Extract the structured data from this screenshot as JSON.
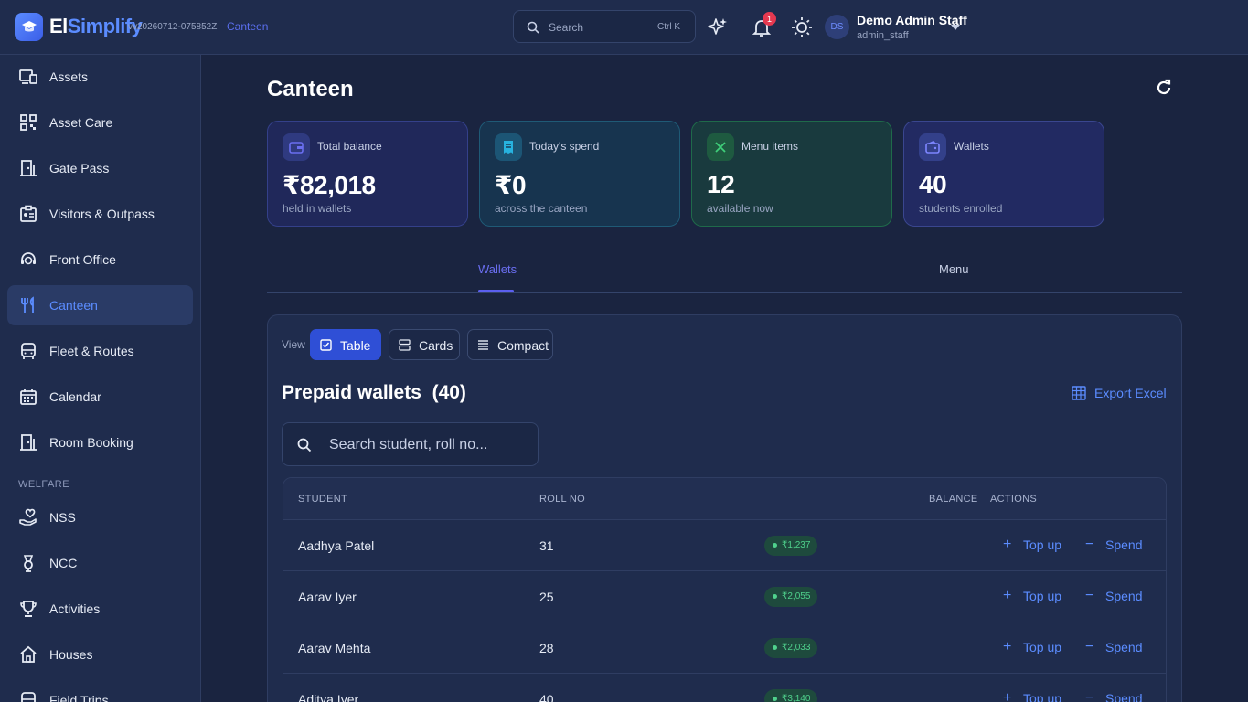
{
  "header": {
    "brand_part1": "El",
    "brand_part2": "Simplify",
    "version": "vv20260712-075852Z",
    "breadcrumb": "Canteen",
    "search_placeholder": "Search",
    "search_shortcut": "Ctrl K",
    "notification_count": "1",
    "user": {
      "initials": "DS",
      "name": "Demo Admin Staff",
      "username": "admin_staff"
    }
  },
  "sidebar": {
    "items": [
      {
        "label": "Assets",
        "icon": "assets-icon"
      },
      {
        "label": "Asset Care",
        "icon": "qr-icon"
      },
      {
        "label": "Gate Pass",
        "icon": "door-icon"
      },
      {
        "label": "Visitors & Outpass",
        "icon": "badge-icon"
      },
      {
        "label": "Front Office",
        "icon": "support-agent-icon"
      },
      {
        "label": "Canteen",
        "icon": "fork-knife-icon",
        "active": true
      },
      {
        "label": "Fleet & Routes",
        "icon": "bus-icon"
      },
      {
        "label": "Calendar",
        "icon": "calendar-icon"
      },
      {
        "label": "Room Booking",
        "icon": "door-icon"
      }
    ],
    "section_label": "WELFARE",
    "welfare_items": [
      {
        "label": "NSS",
        "icon": "hand-heart-icon"
      },
      {
        "label": "NCC",
        "icon": "medal-icon"
      },
      {
        "label": "Activities",
        "icon": "trophy-icon"
      },
      {
        "label": "Houses",
        "icon": "home-icon"
      },
      {
        "label": "Field Trips",
        "icon": "bus-icon"
      }
    ]
  },
  "page": {
    "title": "Canteen",
    "stats": [
      {
        "label": "Total balance",
        "value": "₹82,018",
        "sub": "held in wallets",
        "icon": "wallet-icon"
      },
      {
        "label": "Today's spend",
        "value": "₹0",
        "sub": "across the canteen",
        "icon": "receipt-icon"
      },
      {
        "label": "Menu items",
        "value": "12",
        "sub": "available now",
        "icon": "utensils-icon"
      },
      {
        "label": "Wallets",
        "value": "40",
        "sub": "students enrolled",
        "icon": "wallet-icon"
      }
    ],
    "tabs": [
      {
        "label": "Wallets",
        "active": true
      },
      {
        "label": "Menu"
      }
    ],
    "view_label": "View",
    "views": [
      {
        "label": "Table",
        "active": true
      },
      {
        "label": "Cards"
      },
      {
        "label": "Compact"
      }
    ],
    "section_title": "Prepaid wallets",
    "section_count": "(40)",
    "export_label": "Export Excel",
    "table_search_placeholder": "Search student, roll no...",
    "table": {
      "columns": [
        "STUDENT",
        "ROLL NO",
        "BALANCE",
        "ACTIONS"
      ],
      "rows": [
        {
          "student": "Aadhya Patel",
          "roll": "31",
          "balance": "₹1,237"
        },
        {
          "student": "Aarav Iyer",
          "roll": "25",
          "balance": "₹2,055"
        },
        {
          "student": "Aarav Mehta",
          "roll": "28",
          "balance": "₹2,033"
        },
        {
          "student": "Aditya Iyer",
          "roll": "40",
          "balance": "₹3,140"
        }
      ],
      "action_topup": "Top up",
      "action_spend": "Spend"
    }
  },
  "colors": {
    "accent": "#5b8cff",
    "success": "#4fd18c",
    "danger": "#e53950"
  }
}
